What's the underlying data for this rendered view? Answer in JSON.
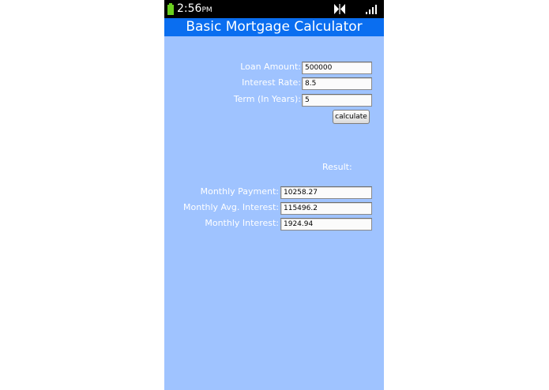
{
  "status_bar": {
    "time": "2:56",
    "ampm": "PM",
    "battery_color": "#6bd11f"
  },
  "app": {
    "title": "Basic Mortgage Calculator",
    "title_bar_color": "#0a6ef0",
    "background_color": "#9fc3ff"
  },
  "inputs": {
    "loan_amount": {
      "label": "Loan Amount:",
      "value": "500000"
    },
    "interest_rate": {
      "label": "Interest Rate:",
      "value": "8.5"
    },
    "term": {
      "label": "Term (In Years):",
      "value": "5"
    }
  },
  "calculate_button": {
    "label": "calculate"
  },
  "result": {
    "heading": "Result:",
    "monthly_payment": {
      "label": "Monthly Payment:",
      "value": "10258.27"
    },
    "monthly_avg_interest": {
      "label": "Monthly Avg. Interest:",
      "value": "115496.2"
    },
    "monthly_interest": {
      "label": "Monthly Interest:",
      "value": "1924.94"
    }
  },
  "icons": {
    "battery": "battery-icon",
    "sync": "sync-icon",
    "signal": "signal-icon"
  }
}
